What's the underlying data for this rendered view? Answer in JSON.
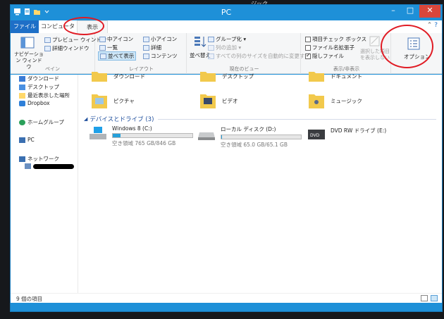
{
  "desktop_text": "ジック",
  "window": {
    "title": "PC"
  },
  "controls": {
    "minimize": "–",
    "maximize": "□",
    "close": "✕"
  },
  "tabs": [
    {
      "label": "ファイル"
    },
    {
      "label": "コンピューター"
    },
    {
      "label": "表示"
    }
  ],
  "ribbon": {
    "pane": {
      "nav_pane": "ナビゲーション ウィンドウ",
      "preview_pane": "プレビュー ウィンドウ",
      "details_pane": "詳細ウィンドウ",
      "label": "ペイン"
    },
    "layout": {
      "medium_icons": "中アイコン",
      "small_icons": "小アイコン",
      "list": "一覧",
      "details": "詳細",
      "tiles": "並べて表示",
      "content": "コンテンツ",
      "label": "レイアウト"
    },
    "current_view": {
      "sort_by": "並べ替え",
      "group_by": "グループ化 ▾",
      "add_columns": "列の追加 ▾",
      "size_all_columns": "すべての列のサイズを自動的に変更する",
      "label": "現在のビュー"
    },
    "show_hide": {
      "item_checkboxes": "項目チェック ボックス",
      "file_extensions": "ファイル名拡張子",
      "hidden_items": "隠しファイル",
      "hide_selected": "選択した項目を表示しない",
      "label": "表示/非表示"
    },
    "options": {
      "label": "オプション"
    }
  },
  "nav": {
    "items": [
      {
        "label": "ダウンロード"
      },
      {
        "label": "デスクトップ"
      },
      {
        "label": "最近表示した場所"
      },
      {
        "label": "Dropbox"
      },
      {
        "label": "ホームグループ"
      },
      {
        "label": "PC"
      },
      {
        "label": "ネットワーク"
      }
    ]
  },
  "folders": [
    {
      "label": "ダウンロード"
    },
    {
      "label": "デスクトップ"
    },
    {
      "label": "ドキュメント"
    },
    {
      "label": "ピクチャ"
    },
    {
      "label": "ビデオ"
    },
    {
      "label": "ミュージック"
    }
  ],
  "section": {
    "title": "デバイスとドライブ (3)"
  },
  "drives": [
    {
      "name": "Windows 8 (C:)",
      "space": "空き領域 765 GB/846 GB",
      "used_fraction": 0.096
    },
    {
      "name": "ローカル ディスク (D:)",
      "space": "空き領域 65.0 GB/65.1 GB",
      "used_fraction": 0.002
    },
    {
      "name": "DVD RW ドライブ (E:)",
      "badge": "DVD"
    }
  ],
  "status": {
    "item_count": "9 個の項目"
  },
  "colors": {
    "accent": "#1e90d8",
    "file_tab": "#1e6fc7",
    "annotation": "#e01b24",
    "drive_fill": "#26a0da"
  }
}
